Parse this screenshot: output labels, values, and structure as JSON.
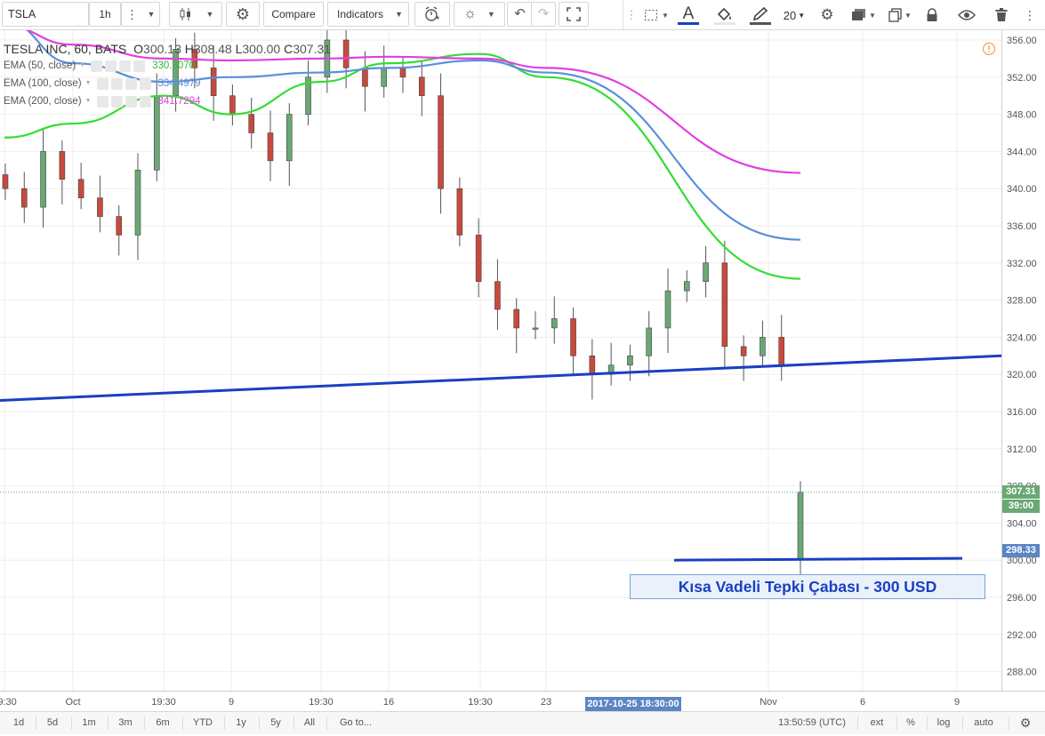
{
  "toolbar": {
    "symbol": "TSLA",
    "interval": "1h",
    "compare_label": "Compare",
    "indicators_label": "Indicators",
    "font_size": "20",
    "drawing_color": "#1a3fc4"
  },
  "legend": {
    "title": "TESLA INC, 60, BATS",
    "ohlc": {
      "open_label": "O",
      "open": "300.13",
      "high_label": "H",
      "high": "308.48",
      "low_label": "L",
      "low": "300.00",
      "close_label": "C",
      "close": "307.31"
    },
    "indicators": [
      {
        "label": "EMA (50, close)",
        "value": "330.3070",
        "color": "#33dd33"
      },
      {
        "label": "EMA (100, close)",
        "value": "334.4979",
        "color": "#5b8fd9"
      },
      {
        "label": "EMA (200, close)",
        "value": "341.7294",
        "color": "#e040e0"
      }
    ]
  },
  "price_labels": {
    "last_price": "307.31",
    "countdown": "39:00",
    "level": "298.33"
  },
  "annotation": "Kısa Vadeli Tepki Çabası - 300 USD",
  "crosshair_date": "2017-10-25 18:30:00",
  "bottom_bar": {
    "ranges": [
      "1d",
      "5d",
      "1m",
      "3m",
      "6m",
      "YTD",
      "1y",
      "5y",
      "All"
    ],
    "goto_label": "Go to...",
    "clock": "13:50:59 (UTC)",
    "options": [
      "ext",
      "%",
      "log",
      "auto"
    ]
  },
  "colors": {
    "up": "#6aa874",
    "down": "#c84a3c",
    "trendline": "#1a3fc4",
    "grid": "#eeeeee",
    "last_price_bg": "#6aa874",
    "level_bg": "#5b86c5"
  },
  "chart_data": {
    "type": "line",
    "title": "TESLA INC, 60, BATS",
    "xlabel": "",
    "ylabel": "",
    "ylim": [
      286,
      358
    ],
    "y_ticks": [
      288,
      292,
      296,
      300,
      304,
      308,
      312,
      316,
      320,
      324,
      328,
      332,
      336,
      340,
      344,
      348,
      352,
      356
    ],
    "x_tick_labels": [
      "19:30",
      "Oct",
      "19:30",
      "9",
      "19:30",
      "16",
      "19:30",
      "23",
      "Nov",
      "6",
      "9"
    ],
    "series": [
      {
        "name": "EMA (50, close)",
        "color": "#33dd33",
        "x": [
          "19:30",
          "Oct",
          "19:30",
          "9",
          "19:30",
          "16",
          "19:30",
          "23",
          "Nov"
        ],
        "values": [
          345.5,
          347.0,
          350.0,
          348.0,
          351.5,
          353.5,
          354.5,
          352.0,
          330.3
        ]
      },
      {
        "name": "EMA (100, close)",
        "color": "#5b8fd9",
        "x": [
          "19:30",
          "Oct",
          "19:30",
          "9",
          "19:30",
          "16",
          "19:30",
          "23",
          "Nov"
        ],
        "values": [
          358.0,
          353.5,
          351.5,
          352.0,
          352.5,
          353.0,
          353.8,
          352.5,
          334.5
        ]
      },
      {
        "name": "EMA (200, close)",
        "color": "#e040e0",
        "x": [
          "19:30",
          "Oct",
          "19:30",
          "9",
          "19:30",
          "16",
          "19:30",
          "23",
          "Nov"
        ],
        "values": [
          357.5,
          355.5,
          354.0,
          353.8,
          354.0,
          354.2,
          354.0,
          353.0,
          341.7
        ]
      },
      {
        "name": "",
        "color": "#1a3fc4",
        "x": [
          "19:30",
          "9"
        ],
        "values": [
          317.2,
          322.0
        ]
      },
      {
        "name": "",
        "color": "#1a3fc4",
        "x": [
          "Nov",
          "9"
        ],
        "values": [
          300.0,
          300.2
        ]
      }
    ],
    "candles_close_approx": [
      340,
      338,
      344,
      341,
      339,
      337,
      335,
      342,
      350,
      355,
      353,
      350,
      348,
      346,
      343,
      348,
      352,
      356,
      353,
      351,
      353,
      352,
      350,
      340,
      335,
      330,
      327,
      325,
      325,
      326,
      322,
      320,
      321,
      322,
      325,
      329,
      330,
      332,
      323,
      322,
      324,
      321,
      307.31
    ],
    "last_price": 307.31,
    "grid": true,
    "legend_position": "top-left"
  }
}
